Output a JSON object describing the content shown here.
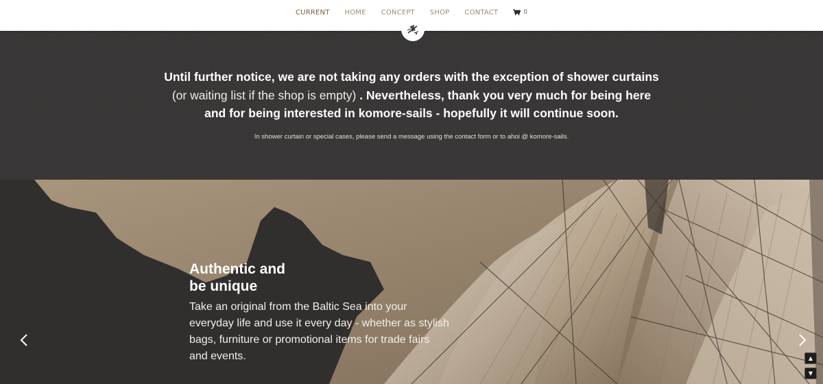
{
  "nav": {
    "items": [
      {
        "label": "CURRENT",
        "current": true
      },
      {
        "label": "HOME"
      },
      {
        "label": "CONCEPT"
      },
      {
        "label": "SHOP"
      },
      {
        "label": "CONTACT"
      }
    ],
    "cart_count": "0",
    "cart_icon": "shopping-cart-icon"
  },
  "logo": {
    "icon": "sail-logo-icon"
  },
  "notice": {
    "line1": "Until further notice, we are not taking any orders with the exception of shower curtains",
    "line2_light": "(or waiting list if the shop is empty)",
    "line2_bold": " . Nevertheless, thank you very much for being here",
    "line3": "and for being interested in komore-sails - hopefully it will continue soon.",
    "small": "In shower curtain or special cases, please send a message using the contact form or to ahoi @ komore-sails."
  },
  "hero": {
    "title_line1": "Authentic and",
    "title_line2": "be unique",
    "body": "Take an original from the Baltic Sea into your everyday life and use it every day - whether as stylish bags, furniture or promotional items for trade fairs and events."
  },
  "slider": {
    "prev_icon": "chevron-left-icon",
    "next_icon": "chevron-right-icon"
  },
  "scroll": {
    "up_icon": "▲",
    "down_icon": "▼"
  },
  "colors": {
    "dark_bg": "#363534",
    "nav_text": "#a08a6e",
    "sail": "#c9b9a4"
  }
}
